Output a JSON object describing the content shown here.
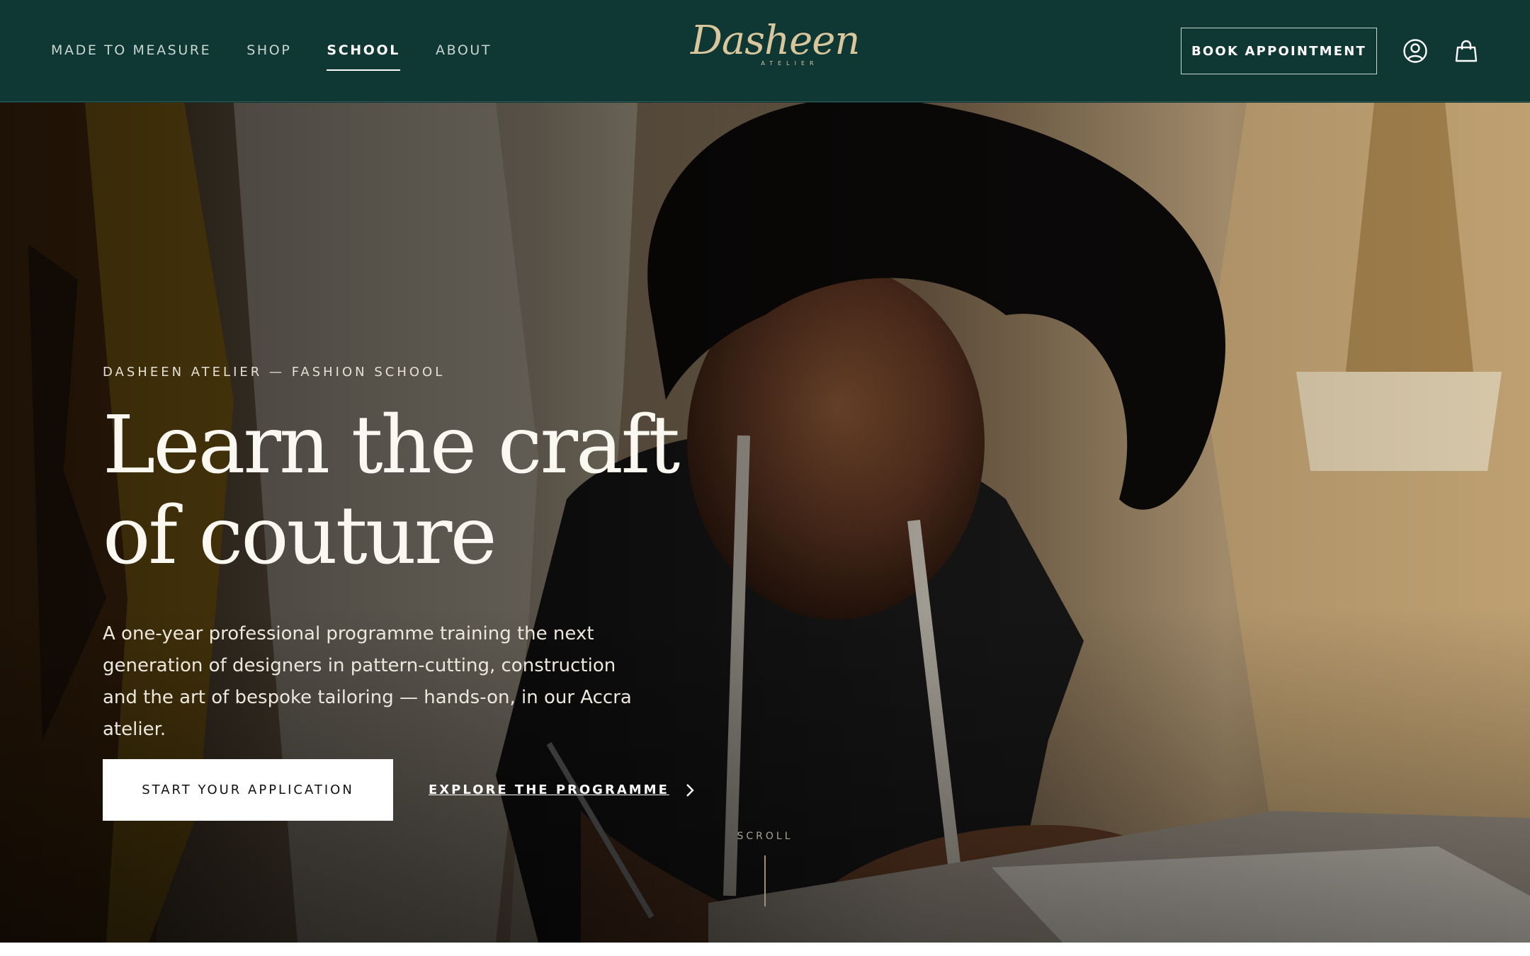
{
  "nav": {
    "items": [
      {
        "label": "MADE TO MEASURE"
      },
      {
        "label": "SHOP"
      },
      {
        "label": "SCHOOL"
      },
      {
        "label": "ABOUT"
      }
    ],
    "active": "SCHOOL"
  },
  "brand": {
    "name": "Dasheen",
    "sub": "ATELIER"
  },
  "header": {
    "book_label": "BOOK APPOINTMENT",
    "account_icon": "user-circle-icon",
    "bag_icon": "shopping-bag-icon"
  },
  "hero": {
    "eyebrow": "DASHEEN ATELIER — FASHION SCHOOL",
    "headline_line1": "Learn the craft",
    "headline_line2": "of couture",
    "lead": "A one-year professional programme training the next generation of designers in pattern-cutting, construction and the art of bespoke tailoring — hands-on, in our Accra atelier.",
    "primary_cta": "START YOUR APPLICATION",
    "secondary_cta": "EXPLORE THE PROGRAMME",
    "scroll_label": "SCROLL"
  },
  "colors": {
    "header_bg": "#0f3733",
    "logo_gold": "#d8c79d",
    "accent_white": "#ffffff"
  }
}
